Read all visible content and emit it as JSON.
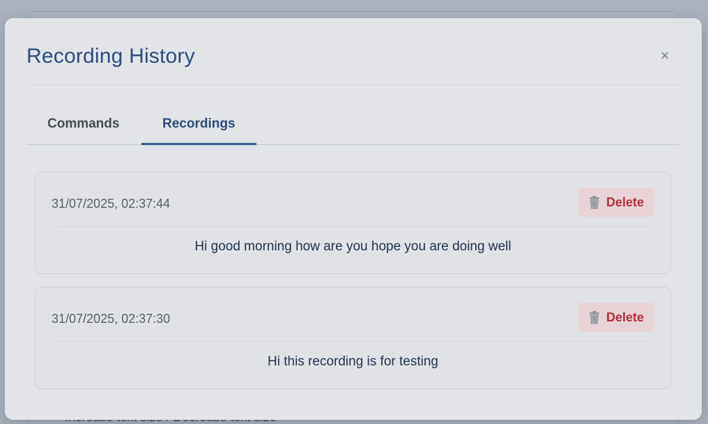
{
  "background": {
    "list_line": {
      "bullet": "•",
      "text": "Increase text size  /  Decrease text size"
    }
  },
  "modal": {
    "title": "Recording History",
    "close_glyph": "×"
  },
  "tabs": [
    {
      "label": "Commands",
      "active": false
    },
    {
      "label": "Recordings",
      "active": true
    }
  ],
  "recordings": [
    {
      "timestamp": "31/07/2025, 02:37:44",
      "delete_label": "Delete",
      "text": "Hi good morning how are you hope you are doing well"
    },
    {
      "timestamp": "31/07/2025, 02:37:30",
      "delete_label": "Delete",
      "text": "Hi this recording is for testing"
    }
  ],
  "icons": {
    "close": "close-icon",
    "delete": "trash-icon"
  },
  "colors": {
    "accent": "#2c4d7c",
    "delete_text": "#b3323f",
    "delete_bg": "#e8d4d7",
    "modal_bg": "#e2e4e8"
  }
}
